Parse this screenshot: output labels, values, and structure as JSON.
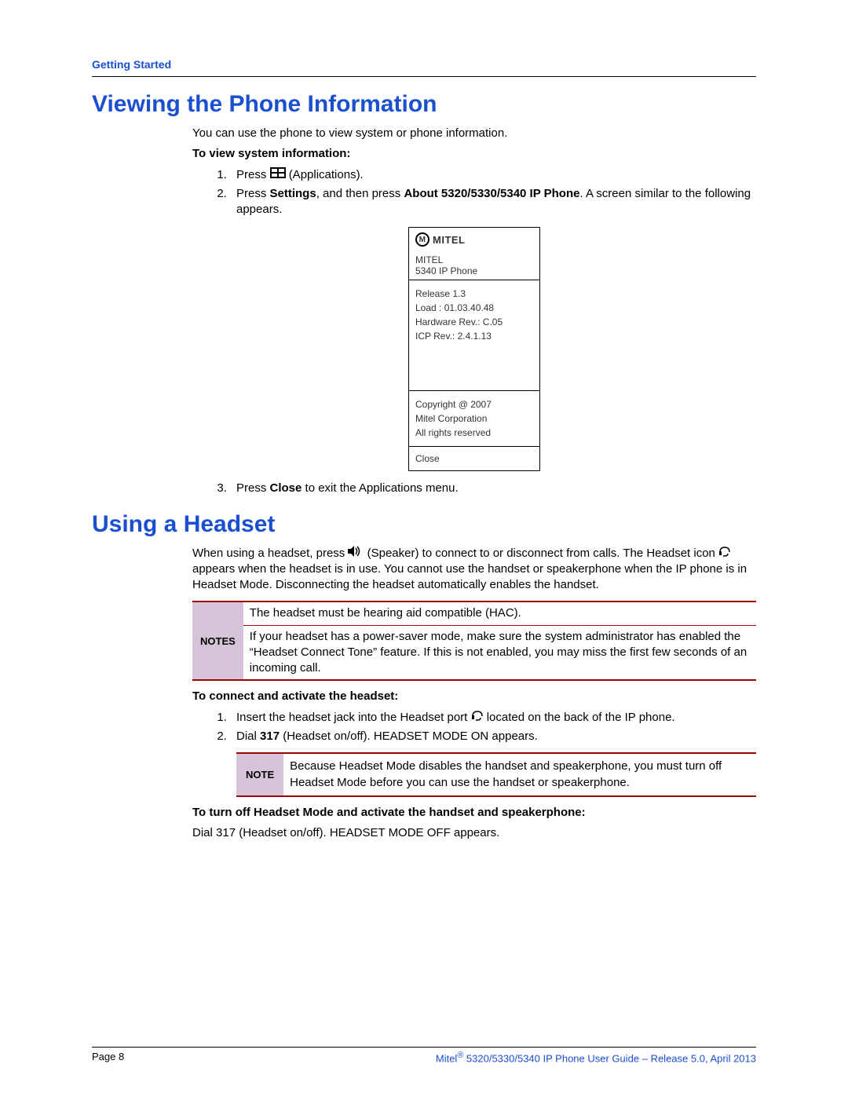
{
  "header": {
    "section_label": "Getting Started"
  },
  "h1_a": "Viewing the Phone Information",
  "intro_a": "You can use the phone to view system or phone information.",
  "sub_a": "To view system information:",
  "step_a1_pre": "Press ",
  "step_a1_icon_label": " (Applications).",
  "step_a2_pre": "Press ",
  "step_a2_b1": "Settings",
  "step_a2_mid": ", and then press ",
  "step_a2_b2": "About 5320/5330/5340 IP Phone",
  "step_a2_post": ". A screen similar to the following appears.",
  "phone_screen": {
    "logo_text": "MITEL",
    "title1": "MITEL",
    "title2": "5340 IP Phone",
    "release": "Release 1.3",
    "load": "Load : 01.03.40.48",
    "hw": "Hardware Rev.: C.05",
    "icp": "ICP Rev.: 2.4.1.13",
    "copyright": "Copyright @ 2007",
    "corp": "Mitel Corporation",
    "rights": "All rights reserved",
    "close": "Close"
  },
  "step_a3_pre": "Press ",
  "step_a3_b": "Close",
  "step_a3_post": " to exit the Applications menu.",
  "h1_b": "Using a Headset",
  "para_b_pre": "When using a headset, press ",
  "para_b_mid1": " (Speaker) to connect to or disconnect from calls. The Headset icon ",
  "para_b_mid2": " appears when the headset is in use. You cannot use the handset or speakerphone when the IP phone is in Headset Mode. Disconnecting the headset automatically enables the handset.",
  "notes_label": "NOTES",
  "notes_row1": "The headset must be hearing aid compatible (HAC).",
  "notes_row2": "If your headset has a power-saver mode, make sure the system administrator has enabled the “Headset Connect Tone” feature. If this is not enabled, you may miss the first few seconds of an incoming call.",
  "sub_b": "To connect and activate the headset:",
  "step_b1_pre": "Insert the headset jack into the Headset port ",
  "step_b1_post": " located on the back of the IP phone.",
  "step_b2_pre": "Dial ",
  "step_b2_b": "317",
  "step_b2_post": " (Headset on/off). HEADSET MODE ON appears.",
  "note_label": "NOTE",
  "note_body": "Because Headset Mode disables the handset and speakerphone, you must turn off Headset Mode before you can use the handset or speakerphone.",
  "sub_c": "To turn off Headset Mode and activate the handset and speakerphone:",
  "para_c": "Dial 317 (Headset on/off). HEADSET MODE OFF appears.",
  "footer": {
    "page": "Page 8",
    "right_pre": "Mitel",
    "right_sup": "®",
    "right_post": " 5320/5330/5340 IP Phone User Guide – Release 5.0, April 2013"
  }
}
